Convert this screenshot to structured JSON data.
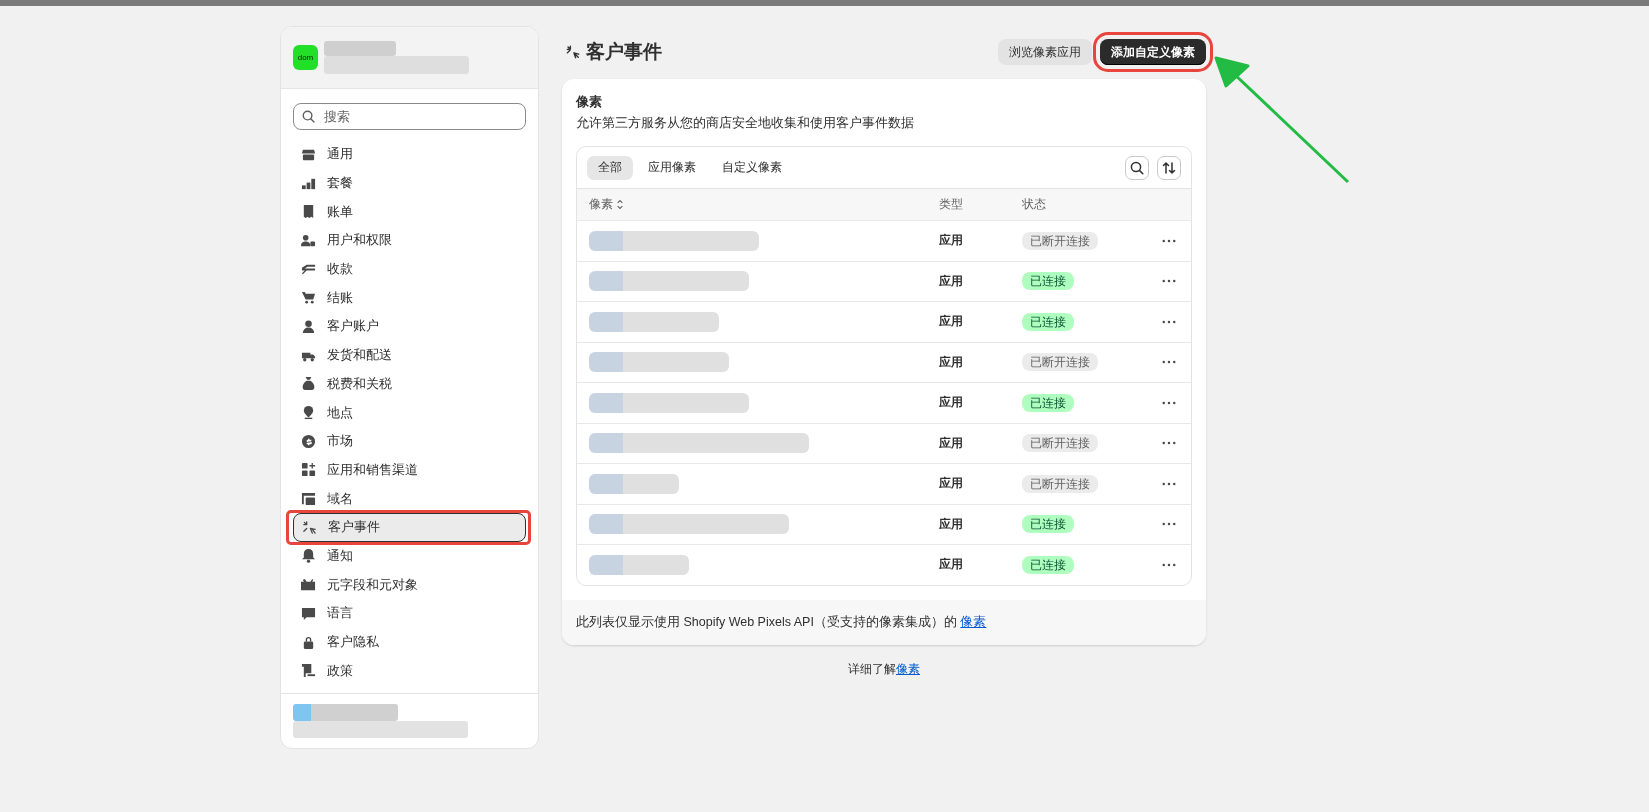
{
  "store": {
    "logo": "dom"
  },
  "search": {
    "placeholder": "搜索"
  },
  "nav": [
    {
      "label": "通用",
      "selected": false,
      "highlighted": false
    },
    {
      "label": "套餐",
      "selected": false,
      "highlighted": false
    },
    {
      "label": "账单",
      "selected": false,
      "highlighted": false
    },
    {
      "label": "用户和权限",
      "selected": false,
      "highlighted": false
    },
    {
      "label": "收款",
      "selected": false,
      "highlighted": false
    },
    {
      "label": "结账",
      "selected": false,
      "highlighted": false
    },
    {
      "label": "客户账户",
      "selected": false,
      "highlighted": false
    },
    {
      "label": "发货和配送",
      "selected": false,
      "highlighted": false
    },
    {
      "label": "税费和关税",
      "selected": false,
      "highlighted": false
    },
    {
      "label": "地点",
      "selected": false,
      "highlighted": false
    },
    {
      "label": "市场",
      "selected": false,
      "highlighted": false
    },
    {
      "label": "应用和销售渠道",
      "selected": false,
      "highlighted": false
    },
    {
      "label": "域名",
      "selected": false,
      "highlighted": false
    },
    {
      "label": "客户事件",
      "selected": true,
      "highlighted": true
    },
    {
      "label": "通知",
      "selected": false,
      "highlighted": false
    },
    {
      "label": "元字段和元对象",
      "selected": false,
      "highlighted": false
    },
    {
      "label": "语言",
      "selected": false,
      "highlighted": false
    },
    {
      "label": "客户隐私",
      "selected": false,
      "highlighted": false
    },
    {
      "label": "政策",
      "selected": false,
      "highlighted": false
    }
  ],
  "page": {
    "title": "客户事件",
    "actions": [
      {
        "label": "浏览像素应用",
        "primary": false,
        "highlighted": false
      },
      {
        "label": "添加自定义像素",
        "primary": true,
        "highlighted": true
      }
    ]
  },
  "card": {
    "title": "像素",
    "description": "允许第三方服务从您的商店安全地收集和使用客户事件数据",
    "tabs": [
      {
        "label": "全部",
        "selected": true
      },
      {
        "label": "应用像素",
        "selected": false
      },
      {
        "label": "自定义像素",
        "selected": false
      }
    ],
    "columns": [
      "像素",
      "类型",
      "状态"
    ],
    "rows": [
      {
        "type": "应用",
        "status": "已断开连接",
        "connected": false
      },
      {
        "type": "应用",
        "status": "已连接",
        "connected": true
      },
      {
        "type": "应用",
        "status": "已连接",
        "connected": true
      },
      {
        "type": "应用",
        "status": "已断开连接",
        "connected": false
      },
      {
        "type": "应用",
        "status": "已连接",
        "connected": true
      },
      {
        "type": "应用",
        "status": "已断开连接",
        "connected": false
      },
      {
        "type": "应用",
        "status": "已断开连接",
        "connected": false
      },
      {
        "type": "应用",
        "status": "已连接",
        "connected": true
      },
      {
        "type": "应用",
        "status": "已连接",
        "connected": true
      }
    ],
    "footer": {
      "text": "此列表仅显示使用 Shopify Web Pixels API（受支持的像素集成）的 ",
      "link": "像素"
    }
  },
  "learn_more": {
    "text": "详细了解",
    "link": "像素"
  }
}
